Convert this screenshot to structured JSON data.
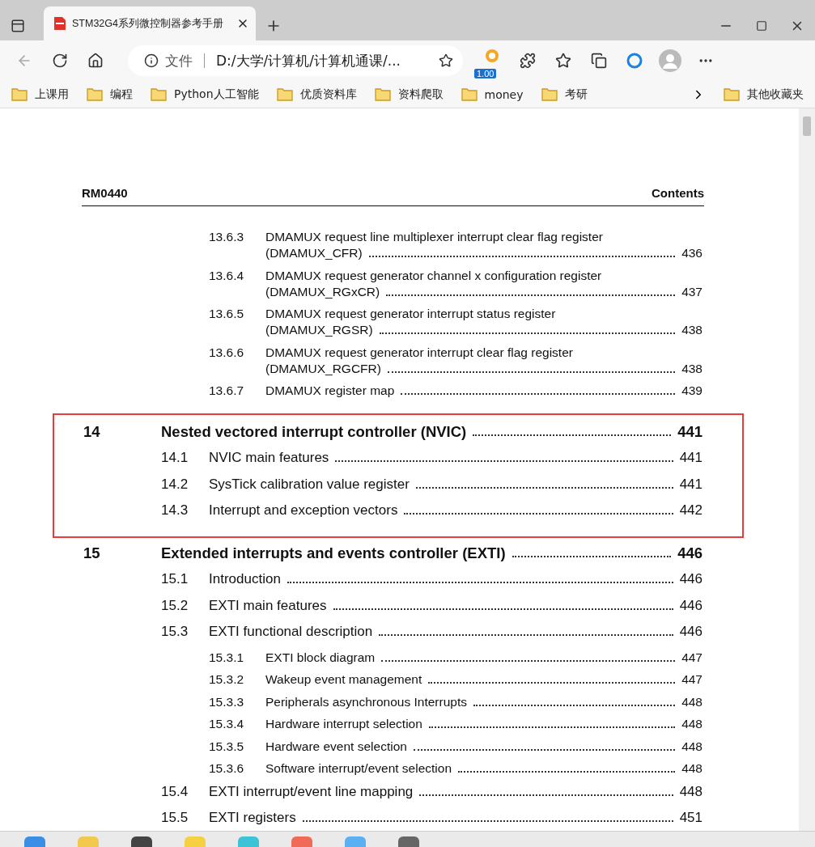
{
  "tab": {
    "title": "STM32G4系列微控制器参考手册",
    "selected": true
  },
  "address_bar": {
    "scheme_label": "文件",
    "url": "D:/大学/计算机/计算机通课/..."
  },
  "extension_badge": "1.00",
  "bookmarks": [
    "上课用",
    "编程",
    "Python人工智能",
    "优质资料库",
    "资料爬取",
    "money",
    "考研"
  ],
  "other_bookmarks": "其他收藏夹",
  "document": {
    "header_left": "RM0440",
    "header_right": "Contents",
    "blocks": [
      {
        "highlighted": false,
        "items": [
          {
            "kind": "subsection",
            "number": "13.6.3",
            "title_lines": [
              "DMAMUX request line multiplexer interrupt clear flag register",
              "(DMAMUX_CFR)"
            ],
            "page": "436"
          },
          {
            "kind": "subsection",
            "number": "13.6.4",
            "title_lines": [
              "DMAMUX request generator channel x configuration register",
              "(DMAMUX_RGxCR)"
            ],
            "page": "437"
          },
          {
            "kind": "subsection",
            "number": "13.6.5",
            "title_lines": [
              "DMAMUX request generator interrupt status register",
              "(DMAMUX_RGSR)"
            ],
            "page": "438"
          },
          {
            "kind": "subsection",
            "number": "13.6.6",
            "title_lines": [
              "DMAMUX request generator interrupt clear flag register",
              "(DMAMUX_RGCFR)"
            ],
            "page": "438"
          },
          {
            "kind": "subsection",
            "number": "13.6.7",
            "title_lines": [
              "DMAMUX register map"
            ],
            "page": "439"
          }
        ]
      },
      {
        "highlighted": true,
        "items": [
          {
            "kind": "chapter",
            "number": "14",
            "title_lines": [
              "Nested vectored interrupt controller (NVIC)"
            ],
            "page": "441"
          },
          {
            "kind": "section",
            "number": "14.1",
            "title_lines": [
              "NVIC main features"
            ],
            "page": "441"
          },
          {
            "kind": "section",
            "number": "14.2",
            "title_lines": [
              "SysTick calibration value register"
            ],
            "page": "441"
          },
          {
            "kind": "section",
            "number": "14.3",
            "title_lines": [
              "Interrupt and exception vectors"
            ],
            "page": "442"
          }
        ]
      },
      {
        "highlighted": false,
        "items": [
          {
            "kind": "chapter",
            "number": "15",
            "title_lines": [
              "Extended interrupts and events controller (EXTI)"
            ],
            "page": "446"
          },
          {
            "kind": "section",
            "number": "15.1",
            "title_lines": [
              "Introduction"
            ],
            "page": "446"
          },
          {
            "kind": "section",
            "number": "15.2",
            "title_lines": [
              "EXTI main features"
            ],
            "page": "446"
          },
          {
            "kind": "section",
            "number": "15.3",
            "title_lines": [
              "EXTI functional description"
            ],
            "page": "446"
          },
          {
            "kind": "subsection",
            "number": "15.3.1",
            "title_lines": [
              "EXTI block diagram"
            ],
            "page": "447"
          },
          {
            "kind": "subsection",
            "number": "15.3.2",
            "title_lines": [
              "Wakeup event management"
            ],
            "page": "447"
          },
          {
            "kind": "subsection",
            "number": "15.3.3",
            "title_lines": [
              "Peripherals asynchronous Interrupts"
            ],
            "page": "448"
          },
          {
            "kind": "subsection",
            "number": "15.3.4",
            "title_lines": [
              "Hardware interrupt selection"
            ],
            "page": "448"
          },
          {
            "kind": "subsection",
            "number": "15.3.5",
            "title_lines": [
              "Hardware event selection"
            ],
            "page": "448"
          },
          {
            "kind": "subsection",
            "number": "15.3.6",
            "title_lines": [
              "Software interrupt/event selection"
            ],
            "page": "448"
          },
          {
            "kind": "section",
            "number": "15.4",
            "title_lines": [
              "EXTI interrupt/event line mapping"
            ],
            "page": "448"
          },
          {
            "kind": "section",
            "number": "15.5",
            "title_lines": [
              "EXTI registers"
            ],
            "page": "451"
          }
        ]
      }
    ]
  }
}
